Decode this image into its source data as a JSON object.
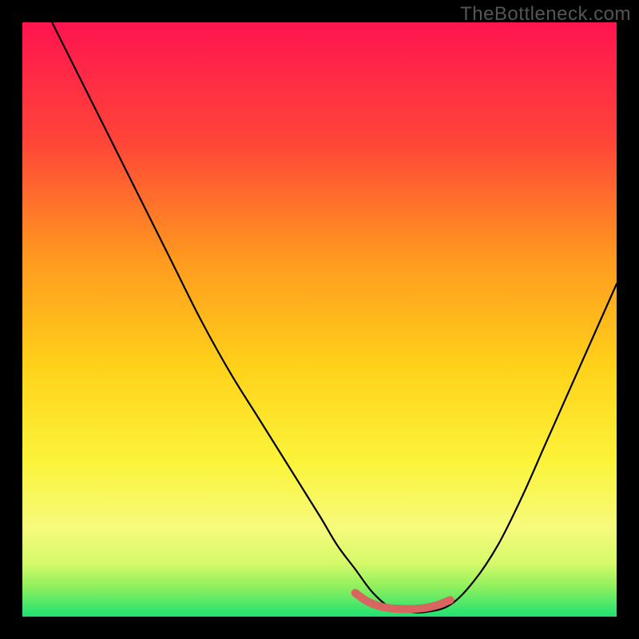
{
  "watermark": "TheBottleneck.com",
  "colors": {
    "frame": "#000000",
    "gradient_top": "#ff1450",
    "gradient_mid_upper": "#ff6a2a",
    "gradient_mid": "#ffd21a",
    "gradient_mid_lower": "#fbf86a",
    "gradient_green_light": "#c9f95a",
    "gradient_green": "#1ee072",
    "curve": "#000000",
    "marker": "#d8655f"
  },
  "chart_data": {
    "type": "line",
    "title": "",
    "xlabel": "",
    "ylabel": "",
    "xlim": [
      0,
      100
    ],
    "ylim": [
      0,
      100
    ],
    "series": [
      {
        "name": "bottleneck-curve",
        "x": [
          5,
          10,
          15,
          20,
          25,
          30,
          35,
          40,
          45,
          50,
          53,
          56,
          59,
          62,
          65,
          68,
          72,
          76,
          80,
          84,
          88,
          92,
          96,
          100
        ],
        "y": [
          100,
          90,
          80,
          70,
          60,
          50,
          41,
          33,
          25,
          17,
          12,
          8,
          4,
          1.5,
          0.8,
          0.8,
          2,
          6,
          12,
          20,
          29,
          38,
          47,
          56
        ]
      },
      {
        "name": "optimal-band-marker",
        "x": [
          56,
          58,
          60,
          62,
          64,
          66,
          68,
          70,
          72
        ],
        "y": [
          4.0,
          2.6,
          1.8,
          1.4,
          1.3,
          1.3,
          1.5,
          2.0,
          2.8
        ]
      }
    ],
    "optimal_range_x": [
      56,
      72
    ]
  }
}
